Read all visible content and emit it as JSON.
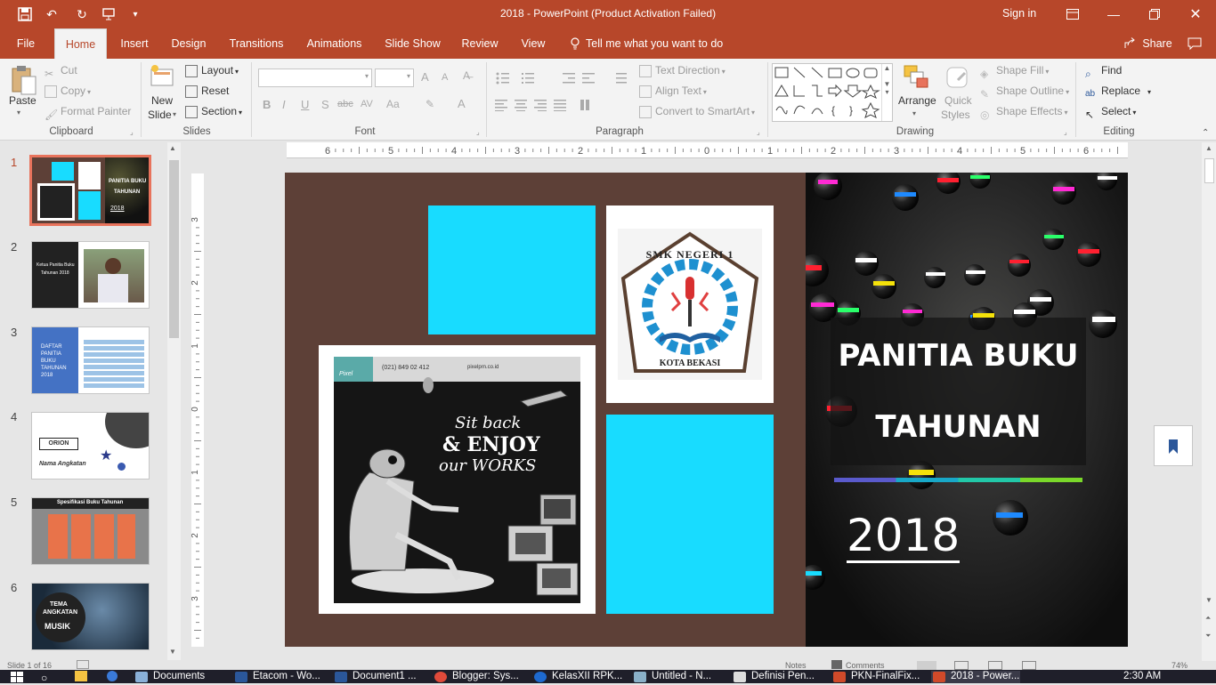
{
  "titlebar": {
    "title": "2018  -  PowerPoint (Product Activation Failed)",
    "signin": "Sign in",
    "quick_access": [
      "save-icon",
      "undo-icon",
      "redo-icon",
      "present-icon",
      "customize-icon"
    ]
  },
  "tabs": [
    {
      "label": "File"
    },
    {
      "label": "Home"
    },
    {
      "label": "Insert"
    },
    {
      "label": "Design"
    },
    {
      "label": "Transitions"
    },
    {
      "label": "Animations"
    },
    {
      "label": "Slide Show"
    },
    {
      "label": "Review"
    },
    {
      "label": "View"
    },
    {
      "label": "Tell me what you want to do"
    }
  ],
  "share_label": "Share",
  "ribbon": {
    "clipboard": {
      "paste": "Paste",
      "cut": "Cut",
      "copy": "Copy",
      "format_painter": "Format Painter",
      "label": "Clipboard"
    },
    "slides": {
      "new_slide_1": "New",
      "new_slide_2": "Slide",
      "layout": "Layout",
      "reset": "Reset",
      "section": "Section",
      "label": "Slides"
    },
    "font": {
      "label": "Font",
      "bold": "B",
      "italic": "I",
      "underline": "U",
      "shadow": "S",
      "strike": "abc",
      "spacing": "AV",
      "case": "Aa",
      "color": "A",
      "grow": "A",
      "shrink": "A"
    },
    "paragraph": {
      "label": "Paragraph",
      "text_direction": "Text Direction",
      "align_text": "Align Text",
      "convert_smartart": "Convert to SmartArt"
    },
    "drawing": {
      "label": "Drawing",
      "arrange": "Arrange",
      "quick_styles_1": "Quick",
      "quick_styles_2": "Styles",
      "shape_fill": "Shape Fill",
      "shape_outline": "Shape Outline",
      "shape_effects": "Shape Effects"
    },
    "editing": {
      "label": "Editing",
      "find": "Find",
      "replace": "Replace",
      "select": "Select"
    }
  },
  "ruler": {
    "h_ticks": [
      "6",
      "5",
      "4",
      "3",
      "2",
      "1",
      "0",
      "1",
      "2",
      "3",
      "4",
      "5",
      "6"
    ],
    "v_ticks": [
      "3",
      "2",
      "1",
      "0",
      "1",
      "2",
      "3"
    ]
  },
  "thumbnails": [
    {
      "num": "1",
      "title": "PANITIA BUKU",
      "sub": "TAHUNAN",
      "year": "2018"
    },
    {
      "num": "2",
      "text1": "Ketua Panitia Buku",
      "text2": "Tahunan 2018"
    },
    {
      "num": "3",
      "text": "DAFTAR PANITIA BUKU TAHUNAN 2018"
    },
    {
      "num": "4",
      "badge": "ORION",
      "text": "Nama Angkatan"
    },
    {
      "num": "5",
      "text": "Spesifikasi Buku Tahunan"
    },
    {
      "num": "6",
      "line1": "TEMA",
      "line2": "ANGKATAN",
      "line3": "MUSIK"
    }
  ],
  "slide": {
    "title_line1": "PANITIA BUKU",
    "title_line2": "TAHUNAN",
    "year": "2018",
    "logo_top": "SMK NEGERI 1",
    "logo_bottom": "KOTA BEKASI",
    "poster_phone": "(021) 849 02 412",
    "poster_web": "pixelprn.co.id",
    "poster_slogan1": "Sit back",
    "poster_slogan2": "& ENJOY",
    "poster_slogan3": "our WORKS",
    "poster_brand": "Pixel"
  },
  "status": {
    "slide_info": "Slide 1 of 16",
    "notes": "Notes",
    "comments": "Comments",
    "zoom": "74%"
  },
  "taskbar": {
    "items": [
      "Documents",
      "Etacom - Wo...",
      "Document1 ...",
      "Blogger: Sys...",
      "KelasXII RPK...",
      "Untitled - N...",
      "Definisi Pen...",
      "PKN-FinalFix...",
      "2018 - Power..."
    ],
    "time": "2:30 AM"
  },
  "colors": {
    "accent": "#b7472a",
    "cyan": "#18dcff",
    "brown": "#5d4037"
  }
}
